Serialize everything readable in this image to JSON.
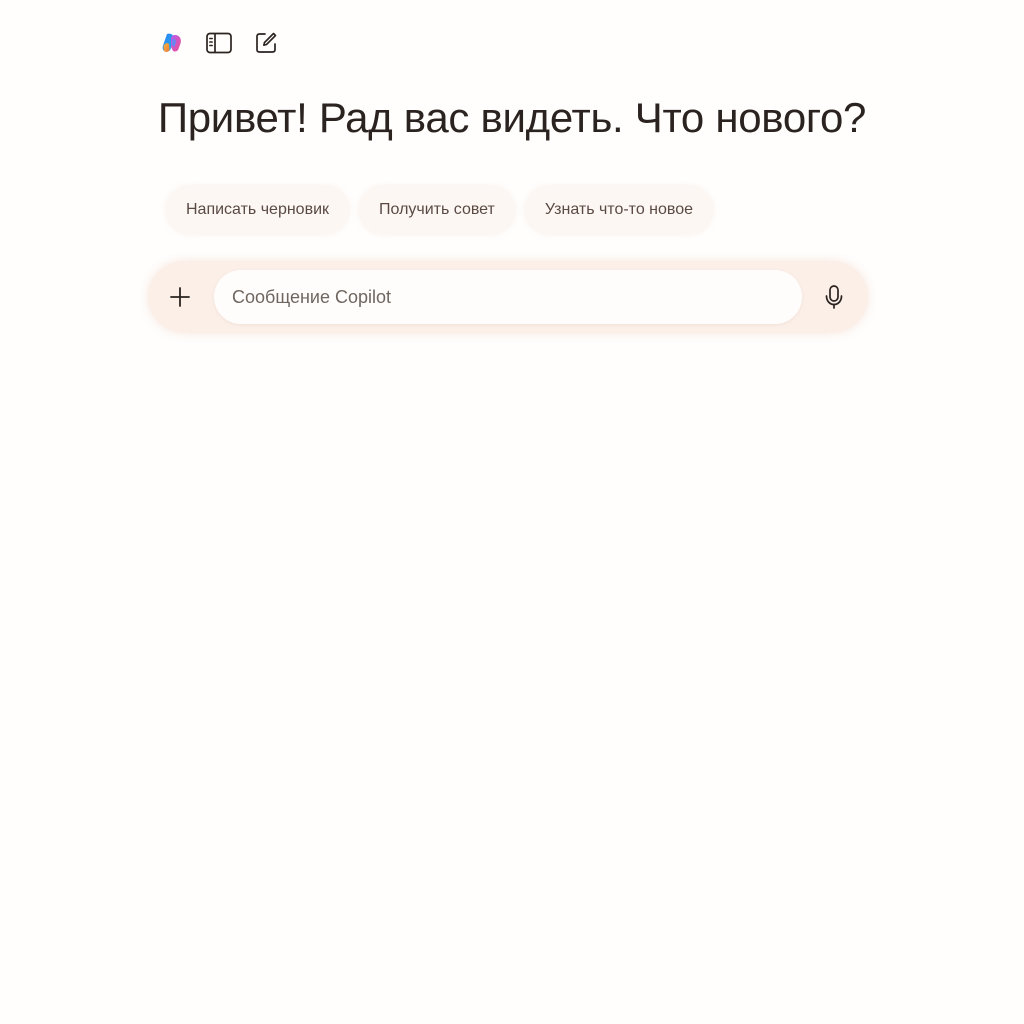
{
  "toolbar": {
    "logo_icon": "copilot-logo-icon",
    "sidebar_icon": "sidebar-toggle-icon",
    "new_chat_icon": "new-chat-icon"
  },
  "greeting": "Привет! Рад вас видеть. Что нового?",
  "suggestions": [
    {
      "label": "Написать черновик"
    },
    {
      "label": "Получить совет"
    },
    {
      "label": "Узнать что-то новое"
    }
  ],
  "composer": {
    "placeholder": "Сообщение Copilot",
    "value": "",
    "add_icon": "plus-icon",
    "mic_icon": "microphone-icon"
  },
  "colors": {
    "background": "#fffefd",
    "text": "#2b2320",
    "chip_background": "#fdf7f3",
    "composer_background": "#fbefe8"
  }
}
